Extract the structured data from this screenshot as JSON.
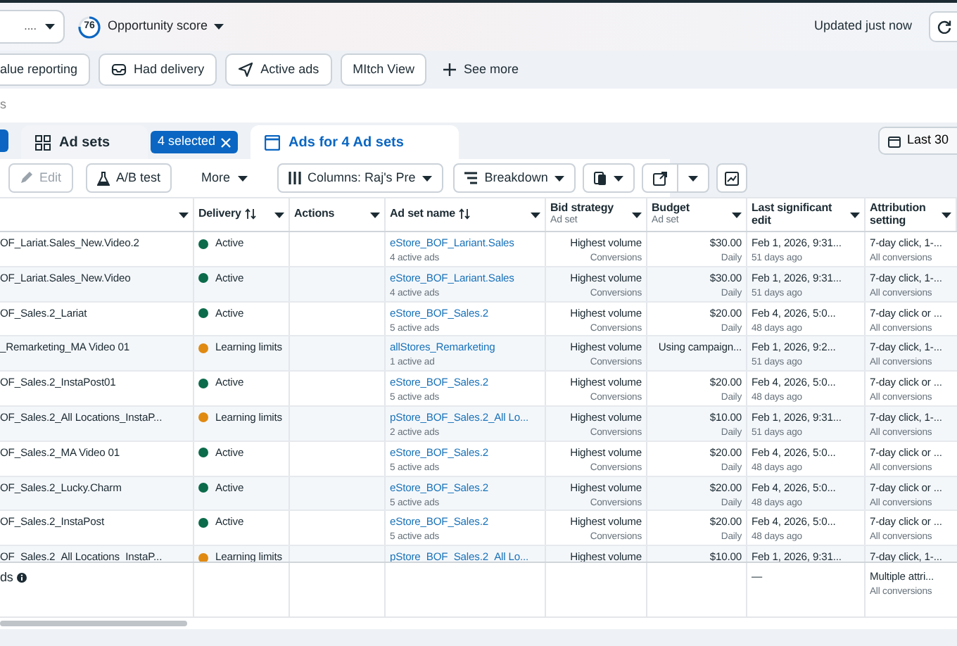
{
  "top_bar": {
    "account_dropdown": "....",
    "opportunity_score": {
      "score": "76",
      "label": "Opportunity score",
      "level": 0.76
    },
    "updated": "Updated just now"
  },
  "filters": [
    {
      "label": "alue reporting",
      "kind": "chip"
    },
    {
      "label": "Had delivery",
      "kind": "chip"
    },
    {
      "label": "Active ads",
      "kind": "chip"
    },
    {
      "label": "MItch View",
      "kind": "chip"
    },
    {
      "label": "See more",
      "kind": "link"
    }
  ],
  "search": {
    "value": "s"
  },
  "tabs": [
    {
      "label": "Ad sets",
      "selected": false
    },
    {
      "label": "Ads for 4 Ad sets",
      "selected": true
    }
  ],
  "selection_badge": "4 selected",
  "date_button": "Last 30",
  "toolbar": {
    "edit": {
      "label": "Edit",
      "disabled": true
    },
    "ab_test": "A/B test",
    "more": "More",
    "columns": "Columns: Raj's Pre",
    "breakdown": "Breakdown"
  },
  "columns": [
    {
      "sortable": false
    },
    {
      "label": "Delivery",
      "sortable": true
    },
    {
      "label": "Actions",
      "sortable": false
    },
    {
      "label": "Ad set name",
      "sortable": true
    },
    {
      "label": "Bid strategy",
      "sub": "Ad set",
      "sortable": false
    },
    {
      "label": "Budget",
      "sub": "Ad set",
      "sortable": false
    },
    {
      "label": "Last significant edit",
      "sortable": false
    },
    {
      "label": "Attribution setting",
      "sortable": false
    }
  ],
  "rows": [
    {
      "name": "OF_Lariat.Sales_New.Video.2",
      "delivery": "Active",
      "color": "#0b6b4a",
      "ad_set": "eStore_BOF_Lariant.Sales",
      "ad_set_sub": "4 active ads",
      "bid": "Highest volume",
      "bid_sub": "Conversions",
      "budget": "$30.00",
      "budget_sub": "Daily",
      "edit": "Feb 1, 2026, 9:31...",
      "edit_sub": "51 days ago",
      "attribution": "7-day click, 1-...",
      "attribution_sub": "All conversions"
    },
    {
      "name": "OF_Lariat.Sales_New.Video",
      "delivery": "Active",
      "color": "#0b6b4a",
      "ad_set": "eStore_BOF_Lariant.Sales",
      "ad_set_sub": "4 active ads",
      "bid": "Highest volume",
      "bid_sub": "Conversions",
      "budget": "$30.00",
      "budget_sub": "Daily",
      "edit": "Feb 1, 2026, 9:31...",
      "edit_sub": "51 days ago",
      "attribution": "7-day click, 1-...",
      "attribution_sub": "All conversions"
    },
    {
      "name": "OF_Sales.2_Lariat",
      "delivery": "Active",
      "color": "#0b6b4a",
      "ad_set": "eStore_BOF_Sales.2",
      "ad_set_sub": "5 active ads",
      "bid": "Highest volume",
      "bid_sub": "Conversions",
      "budget": "$20.00",
      "budget_sub": "Daily",
      "edit": "Feb 4, 2026, 5:0...",
      "edit_sub": "48 days ago",
      "attribution": "7-day click or ...",
      "attribution_sub": "All conversions"
    },
    {
      "name": "_Remarketing_MA Video 01",
      "delivery": "Learning limits",
      "color": "#e08a12",
      "ad_set": "allStores_Remarketing",
      "ad_set_sub": "1 active ad",
      "bid": "Highest volume",
      "bid_sub": "Conversions",
      "budget": "Using campaign...",
      "edit": "Feb 1, 2026, 9:2...",
      "edit_sub": "51 days ago",
      "attribution": "7-day click, 1-...",
      "attribution_sub": "All conversions"
    },
    {
      "name": "OF_Sales.2_InstaPost01",
      "delivery": "Active",
      "color": "#0b6b4a",
      "ad_set": "eStore_BOF_Sales.2",
      "ad_set_sub": "5 active ads",
      "bid": "Highest volume",
      "bid_sub": "Conversions",
      "budget": "$20.00",
      "budget_sub": "Daily",
      "edit": "Feb 4, 2026, 5:0...",
      "edit_sub": "48 days ago",
      "attribution": "7-day click or ...",
      "attribution_sub": "All conversions"
    },
    {
      "name": "OF_Sales.2_All Locations_InstaP...",
      "delivery": "Learning limits",
      "color": "#e08a12",
      "ad_set": "pStore_BOF_Sales.2_All Lo...",
      "ad_set_sub": "2 active ads",
      "bid": "Highest volume",
      "bid_sub": "Conversions",
      "budget": "$10.00",
      "budget_sub": "Daily",
      "edit": "Feb 1, 2026, 9:31...",
      "edit_sub": "51 days ago",
      "attribution": "7-day click, 1-...",
      "attribution_sub": "All conversions"
    },
    {
      "name": "OF_Sales.2_MA Video 01",
      "delivery": "Active",
      "color": "#0b6b4a",
      "ad_set": "eStore_BOF_Sales.2",
      "ad_set_sub": "5 active ads",
      "bid": "Highest volume",
      "bid_sub": "Conversions",
      "budget": "$20.00",
      "budget_sub": "Daily",
      "edit": "Feb 4, 2026, 5:0...",
      "edit_sub": "48 days ago",
      "attribution": "7-day click or ...",
      "attribution_sub": "All conversions"
    },
    {
      "name": "OF_Sales.2_Lucky.Charm",
      "delivery": "Active",
      "color": "#0b6b4a",
      "ad_set": "eStore_BOF_Sales.2",
      "ad_set_sub": "5 active ads",
      "bid": "Highest volume",
      "bid_sub": "Conversions",
      "budget": "$20.00",
      "budget_sub": "Daily",
      "edit": "Feb 4, 2026, 5:0...",
      "edit_sub": "48 days ago",
      "attribution": "7-day click or ...",
      "attribution_sub": "All conversions"
    },
    {
      "name": "OF_Sales.2_InstaPost",
      "delivery": "Active",
      "color": "#0b6b4a",
      "ad_set": "eStore_BOF_Sales.2",
      "ad_set_sub": "5 active ads",
      "bid": "Highest volume",
      "bid_sub": "Conversions",
      "budget": "$20.00",
      "budget_sub": "Daily",
      "edit": "Feb 4, 2026, 5:0...",
      "edit_sub": "48 days ago",
      "attribution": "7-day click or ...",
      "attribution_sub": "All conversions"
    },
    {
      "name": "OF_Sales.2_All Locations_InstaP...",
      "delivery": "Learning limits",
      "color": "#e08a12",
      "ad_set": "pStore_BOF_Sales.2_All Lo...",
      "bid": "Highest volume",
      "budget": "$10.00",
      "edit": "Feb 1, 2026, 9:31...",
      "attribution": "7-day click, 1-..."
    }
  ],
  "summary": {
    "name": "ds",
    "edit": "—",
    "attribution": "Multiple attri...",
    "attribution_sub": "All conversions"
  }
}
